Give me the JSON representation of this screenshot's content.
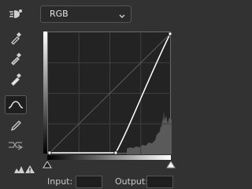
{
  "channel": {
    "value": "RGB",
    "options": [
      "RGB"
    ]
  },
  "tools": [
    {
      "name": "on-image-adjust",
      "icon": "hand-target-icon"
    },
    {
      "name": "sample-black",
      "icon": "eyedropper-black-icon"
    },
    {
      "name": "sample-gray",
      "icon": "eyedropper-gray-icon"
    },
    {
      "name": "sample-white",
      "icon": "eyedropper-white-icon"
    },
    {
      "name": "edit-points",
      "icon": "curve-icon",
      "active": true
    },
    {
      "name": "draw-curve",
      "icon": "pencil-icon"
    },
    {
      "name": "smooth",
      "icon": "smooth-icon"
    }
  ],
  "warning_icon": "clipping-warning-icon",
  "curve": {
    "points": [
      {
        "input": 0,
        "output": 0
      },
      {
        "input": 140,
        "output": 0
      },
      {
        "input": 255,
        "output": 255
      }
    ]
  },
  "io": {
    "input_label": "Input:",
    "output_label": "Output:"
  }
}
